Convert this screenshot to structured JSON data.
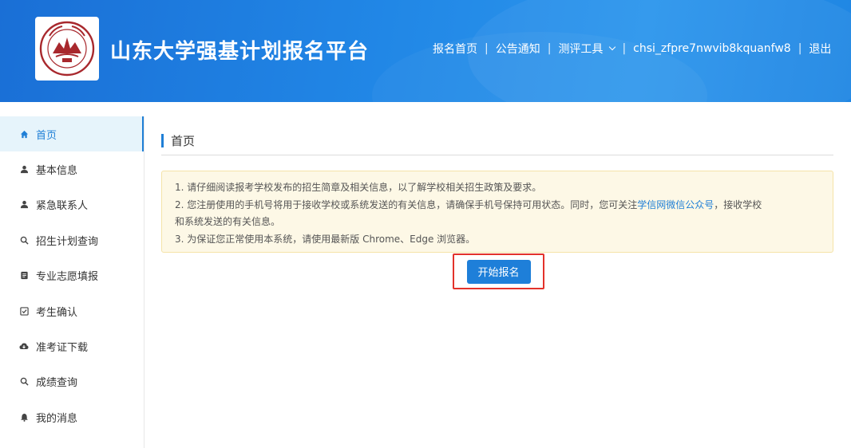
{
  "header": {
    "site_title": "山东大学强基计划报名平台",
    "logo_year": "1901",
    "logo_ring_text": "SHANDONG UNIVERSITY",
    "nav": [
      {
        "label": "报名首页"
      },
      {
        "label": "公告通知"
      },
      {
        "label": "测评工具",
        "has_dropdown": true
      },
      {
        "label": "chsi_zfpre7nwvib8kquanfw8"
      },
      {
        "label": "退出"
      }
    ],
    "separator": "|"
  },
  "sidebar": {
    "items": [
      {
        "label": "首页",
        "icon": "home-icon",
        "active": true
      },
      {
        "label": "基本信息",
        "icon": "user-icon"
      },
      {
        "label": "紧急联系人",
        "icon": "user-icon"
      },
      {
        "label": "招生计划查询",
        "icon": "search-icon"
      },
      {
        "label": "专业志愿填报",
        "icon": "document-icon"
      },
      {
        "label": "考生确认",
        "icon": "checkbox-icon"
      },
      {
        "label": "准考证下载",
        "icon": "cloud-download-icon"
      },
      {
        "label": "成绩查询",
        "icon": "search-icon"
      },
      {
        "label": "我的消息",
        "icon": "bell-icon"
      }
    ]
  },
  "main": {
    "page_title": "首页",
    "notice": {
      "line1": "1. 请仔细阅读报考学校发布的招生简章及相关信息，以了解学校相关招生政策及要求。",
      "line2_pre": "2. 您注册使用的手机号将用于接收学校或系统发送的有关信息，请确保手机号保持可用状态。同时，您可关注",
      "line2_link": "学信网微信公众号",
      "line2_post": "，接收学校",
      "line2_cont": "和系统发送的有关信息。",
      "line3": "3. 为保证您正常使用本系统，请使用最新版 Chrome、Edge 浏览器。"
    },
    "start_button": "开始报名"
  },
  "colors": {
    "header_blue": "#2187e6",
    "accent": "#1f7fd6",
    "notice_bg": "#fdf8e6",
    "highlight_red": "#e3322b"
  }
}
